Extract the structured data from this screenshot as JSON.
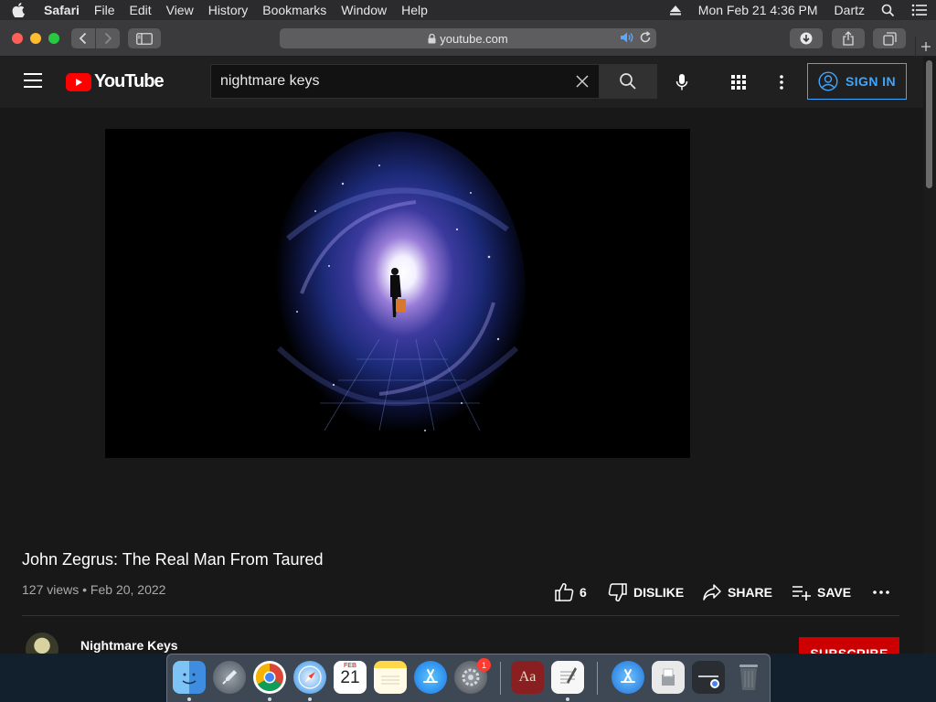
{
  "menubar": {
    "app_name": "Safari",
    "items": [
      "File",
      "Edit",
      "View",
      "History",
      "Bookmarks",
      "Window",
      "Help"
    ],
    "clock": "Mon Feb 21  4:36 PM",
    "user": "Dartz"
  },
  "browser": {
    "url": "youtube.com"
  },
  "youtube": {
    "logo_text": "YouTube",
    "search_value": "nightmare keys",
    "sign_in_label": "SIGN IN",
    "video": {
      "title": "John Zegrus: The Real Man From Taured",
      "meta": "127 views • Feb 20, 2022",
      "like_count": "6",
      "dislike_label": "DISLIKE",
      "share_label": "SHARE",
      "save_label": "SAVE",
      "channel_name": "Nightmare Keys",
      "subscribe_label": "SUBSCRIBE"
    }
  },
  "dock": {
    "calendar_month": "FEB",
    "calendar_day": "21",
    "system_prefs_badge": "1"
  },
  "colors": {
    "youtube_red": "#ff0000",
    "signin_blue": "#3ea6ff",
    "subscribe_red": "#cc0000"
  }
}
